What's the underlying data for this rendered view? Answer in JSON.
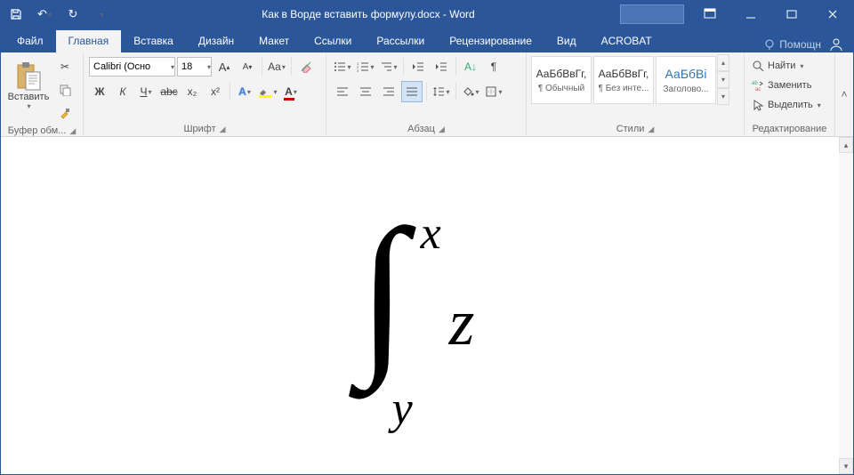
{
  "title": "Как в Ворде вставить формулу.docx - Word",
  "tabs": [
    "Файл",
    "Главная",
    "Вставка",
    "Дизайн",
    "Макет",
    "Ссылки",
    "Рассылки",
    "Рецензирование",
    "Вид",
    "ACROBAT"
  ],
  "active_tab": 1,
  "tell_me": "Помощн",
  "clipboard": {
    "paste": "Вставить",
    "group": "Буфер обм..."
  },
  "font": {
    "name": "Calibri (Осно",
    "size": "18",
    "group": "Шрифт",
    "case": "Aa",
    "bold": "Ж",
    "italic": "К",
    "underline": "Ч",
    "strike": "abc",
    "sub": "x₂",
    "sup": "x²"
  },
  "para": {
    "group": "Абзац"
  },
  "styles": {
    "group": "Стили",
    "items": [
      {
        "preview": "АаБбВвГг,",
        "name": "¶ Обычный",
        "accent": false
      },
      {
        "preview": "АаБбВвГг,",
        "name": "¶ Без инте...",
        "accent": false
      },
      {
        "preview": "АаБбВі",
        "name": "Заголово...",
        "accent": true
      }
    ]
  },
  "editing": {
    "group": "Редактирование",
    "find": "Найти",
    "replace": "Заменить",
    "select": "Выделить"
  },
  "formula": {
    "upper": "x",
    "lower": "y",
    "body": "z"
  },
  "colors": {
    "accent": "#2b579a",
    "light": "#f3f3f3"
  }
}
